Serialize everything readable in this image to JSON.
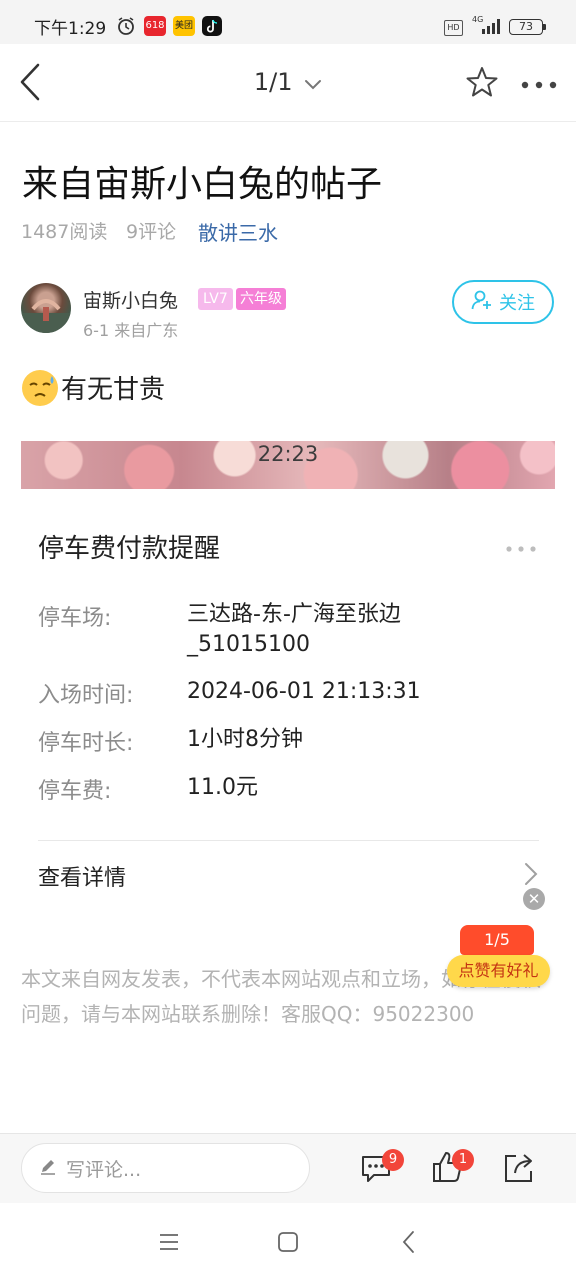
{
  "status_bar": {
    "time": "下午1:29",
    "battery": "73",
    "network": "4G",
    "hd": "HD",
    "app_badges": [
      "618",
      "美团"
    ]
  },
  "nav": {
    "page_indicator": "1/1"
  },
  "post": {
    "title": "来自宙斯小白兔的帖子",
    "reads": "1487阅读",
    "comments": "9评论",
    "topic": "散讲三水",
    "author": "宙斯小白兔",
    "level": "LV7",
    "grade": "六年级",
    "date_location": "6-1  来自广东",
    "follow_label": "关注",
    "content_text": "有无甘贵"
  },
  "screenshot_card": {
    "banner_time": "22:23",
    "title": "停车费付款提醒",
    "rows": [
      {
        "label": "停车场:",
        "value_line1": "三达路-东-广海至张边",
        "value_line2": "_51015100"
      },
      {
        "label": "入场时间:",
        "value": "2024-06-01 21:13:31"
      },
      {
        "label": "停车时长:",
        "value": "1小时8分钟"
      },
      {
        "label": "停车费:",
        "value": "11.0元"
      }
    ],
    "detail_label": "查看详情"
  },
  "disclaimer": "本文来自网友发表，不代表本网站观点和立场，如存在侵权问题，请与本网站联系删除！客服QQ：95022300",
  "promo": {
    "counter": "1/5",
    "label": "点赞有好礼"
  },
  "bottom_bar": {
    "comment_placeholder": "写评论...",
    "comment_count": "9",
    "like_count": "1"
  },
  "colors": {
    "accent_blue": "#2ec3e8",
    "topic_blue": "#3b6aa8",
    "badge_red": "#f2453a",
    "level_pink": "#f6b9ec",
    "grade_pink": "#f57fd6"
  }
}
